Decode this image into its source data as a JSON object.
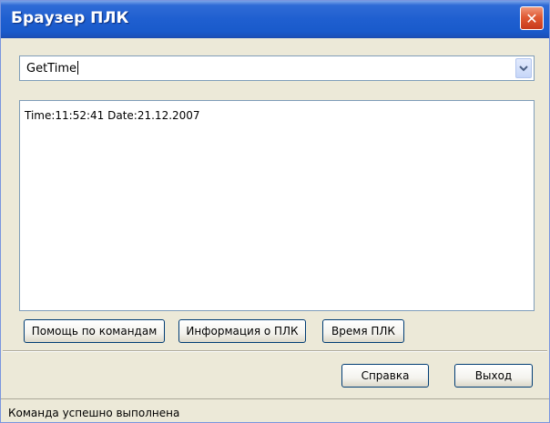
{
  "window": {
    "title": "Браузер ПЛК",
    "close_symbol": "✕"
  },
  "command_input": {
    "value": "GetTime",
    "dropdown_icon": "chevron-down-icon"
  },
  "output": {
    "text": "Time:11:52:41 Date:21.12.2007"
  },
  "buttons": {
    "help_commands": "Помощь по командам",
    "plc_info": "Информация о ПЛК",
    "plc_time": "Время ПЛК",
    "help": "Справка",
    "exit": "Выход"
  },
  "status": {
    "text": "Команда успешно выполнена"
  },
  "colors": {
    "titlebar": "#1f5fd0",
    "window_bg": "#ece9d8",
    "close_button": "#e05a33",
    "field_border": "#7f9db9"
  }
}
